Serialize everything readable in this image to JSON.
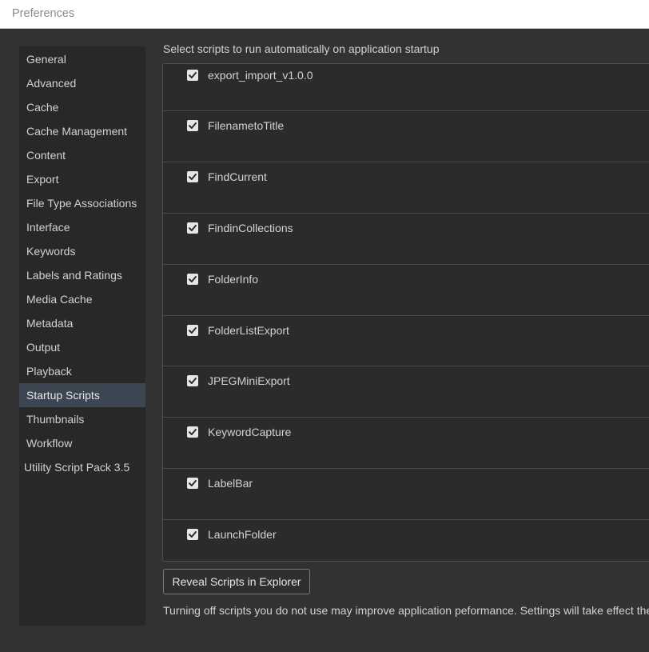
{
  "window": {
    "title": "Preferences"
  },
  "sidebar": {
    "selected": "Startup Scripts",
    "items": [
      "General",
      "Advanced",
      "Cache",
      "Cache Management",
      "Content",
      "Export",
      "File Type Associations",
      "Interface",
      "Keywords",
      "Labels and Ratings",
      "Media Cache",
      "Metadata",
      "Output",
      "Playback",
      "Startup Scripts",
      "Thumbnails",
      "Workflow",
      "Utility Script Pack 3.5"
    ]
  },
  "main": {
    "heading": "Select scripts to run automatically on application startup",
    "scripts": [
      {
        "name": "export_import_v1.0.0",
        "checked": true
      },
      {
        "name": "FilenametoTitle",
        "checked": true
      },
      {
        "name": "FindCurrent",
        "checked": true
      },
      {
        "name": "FindinCollections",
        "checked": true
      },
      {
        "name": "FolderInfo",
        "checked": true
      },
      {
        "name": "FolderListExport",
        "checked": true
      },
      {
        "name": "JPEGMiniExport",
        "checked": true
      },
      {
        "name": "KeywordCapture",
        "checked": true
      },
      {
        "name": "LabelBar",
        "checked": true
      },
      {
        "name": "LaunchFolder",
        "checked": true
      }
    ],
    "reveal_button_label": "Reveal Scripts in Explorer",
    "footer_note": "Turning off scripts you do not use may improve application peformance. Settings will take effect the n"
  },
  "colors": {
    "background": "#323232",
    "sidebar_bg": "#282828",
    "selected_bg": "#3c4653",
    "text": "#d2d2d2",
    "checkbox": "#e6e6e6"
  },
  "icons": {
    "checkbox": "checkmark-icon"
  }
}
